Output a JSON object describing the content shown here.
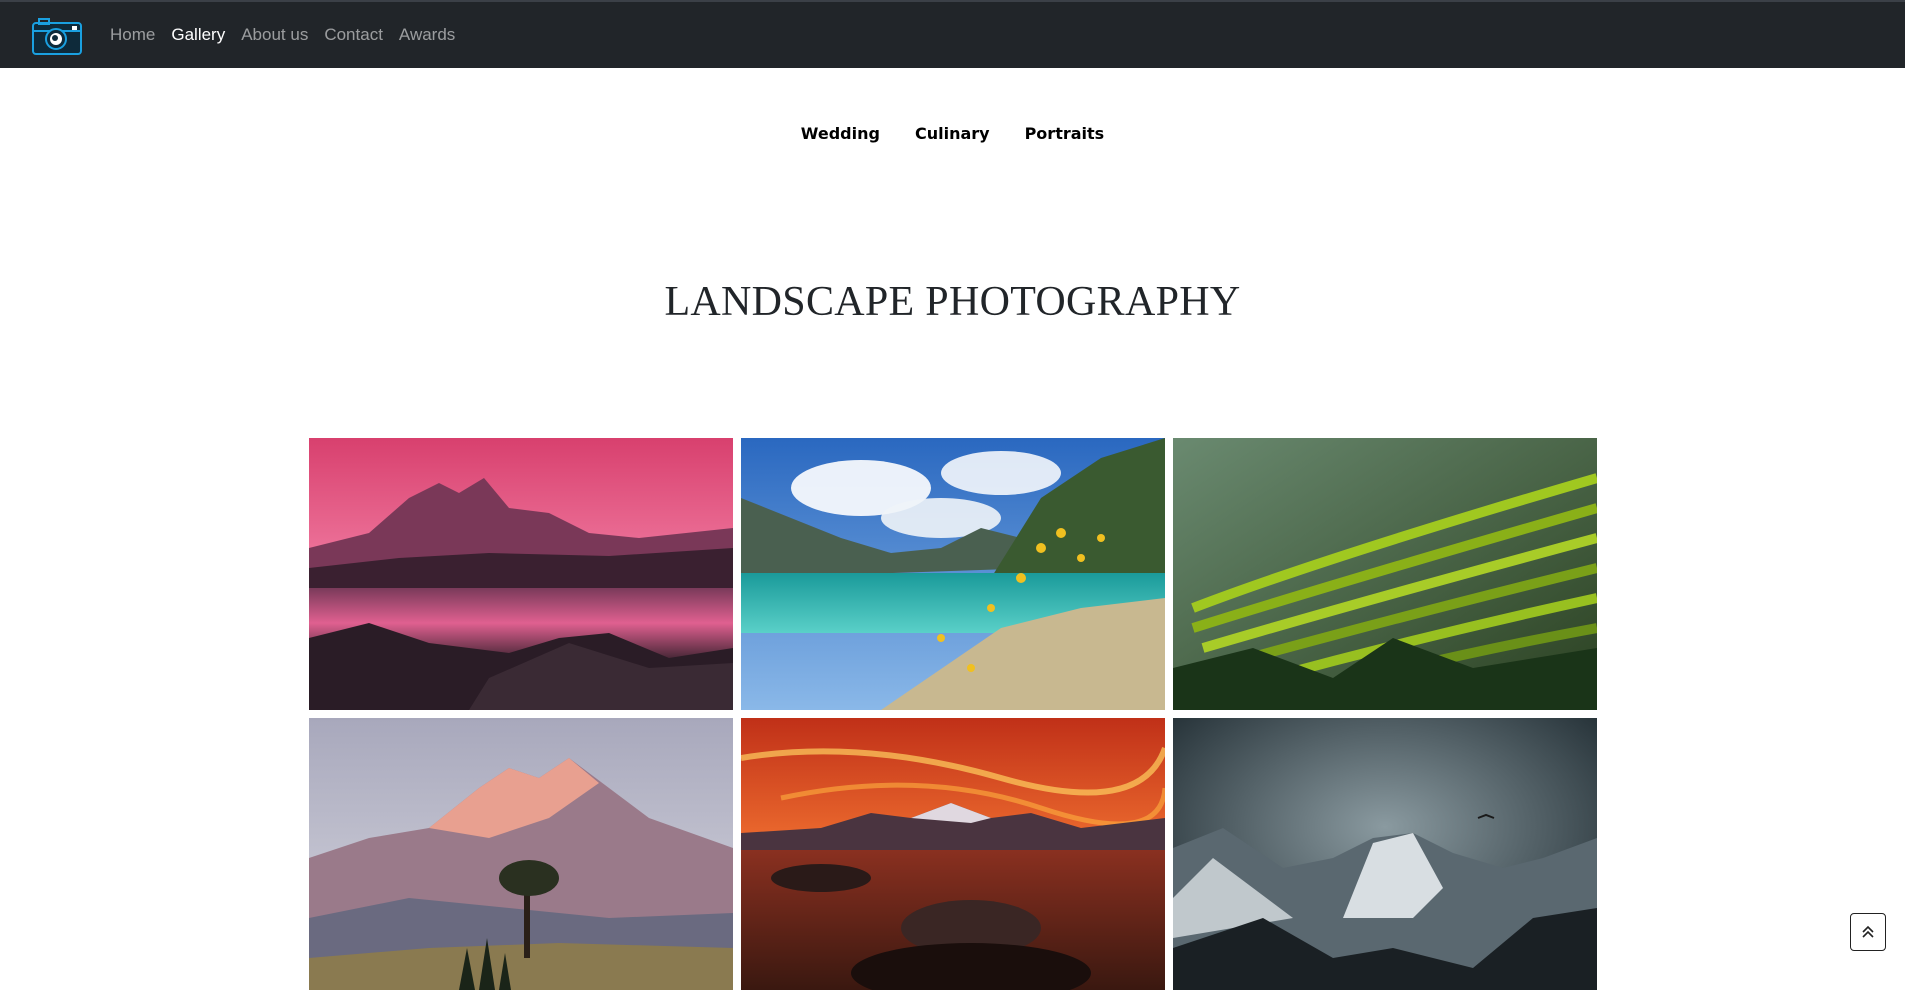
{
  "nav": {
    "logo_icon": "camera-icon",
    "links": [
      {
        "label": "Home",
        "active": false
      },
      {
        "label": "Gallery",
        "active": true
      },
      {
        "label": "About us",
        "active": false
      },
      {
        "label": "Contact",
        "active": false
      },
      {
        "label": "Awards",
        "active": false
      }
    ]
  },
  "categories": [
    "Wedding",
    "Culinary",
    "Portraits"
  ],
  "page_title": "LANDSCAPE PHOTOGRAPHY",
  "gallery": {
    "photos": [
      {
        "name": "pink-mountain-lake-reflection",
        "palette": {
          "sky": "#e05a8a",
          "mountain": "#7a3a5a",
          "water": "#c04a7a",
          "ground": "#2a1f28"
        }
      },
      {
        "name": "turquoise-alpine-lake-flowers",
        "palette": {
          "sky": "#3a78c8",
          "mountain": "#4a6a50",
          "water": "#2ab8b0",
          "ground": "#c8b898"
        }
      },
      {
        "name": "rice-terraces-green",
        "palette": {
          "sky": "#5a7a60",
          "mountain": "#3a5a30",
          "water": "#8ab020",
          "ground": "#1f3a1a"
        }
      },
      {
        "name": "pink-peaks-lone-tree",
        "palette": {
          "sky": "#b8b8c8",
          "mountain": "#c88878",
          "water": "#5a5a78",
          "ground": "#8a7a50"
        }
      },
      {
        "name": "fiery-sunset-lake",
        "palette": {
          "sky": "#e05020",
          "mountain": "#4a3038",
          "water": "#b03a20",
          "ground": "#2a1a18"
        }
      },
      {
        "name": "misty-snowy-peaks",
        "palette": {
          "sky": "#3a4a50",
          "mountain": "#a8b0b4",
          "water": "#506068",
          "ground": "#1a2024"
        }
      }
    ]
  },
  "scroll_top_icon": "double-chevron-up-icon"
}
